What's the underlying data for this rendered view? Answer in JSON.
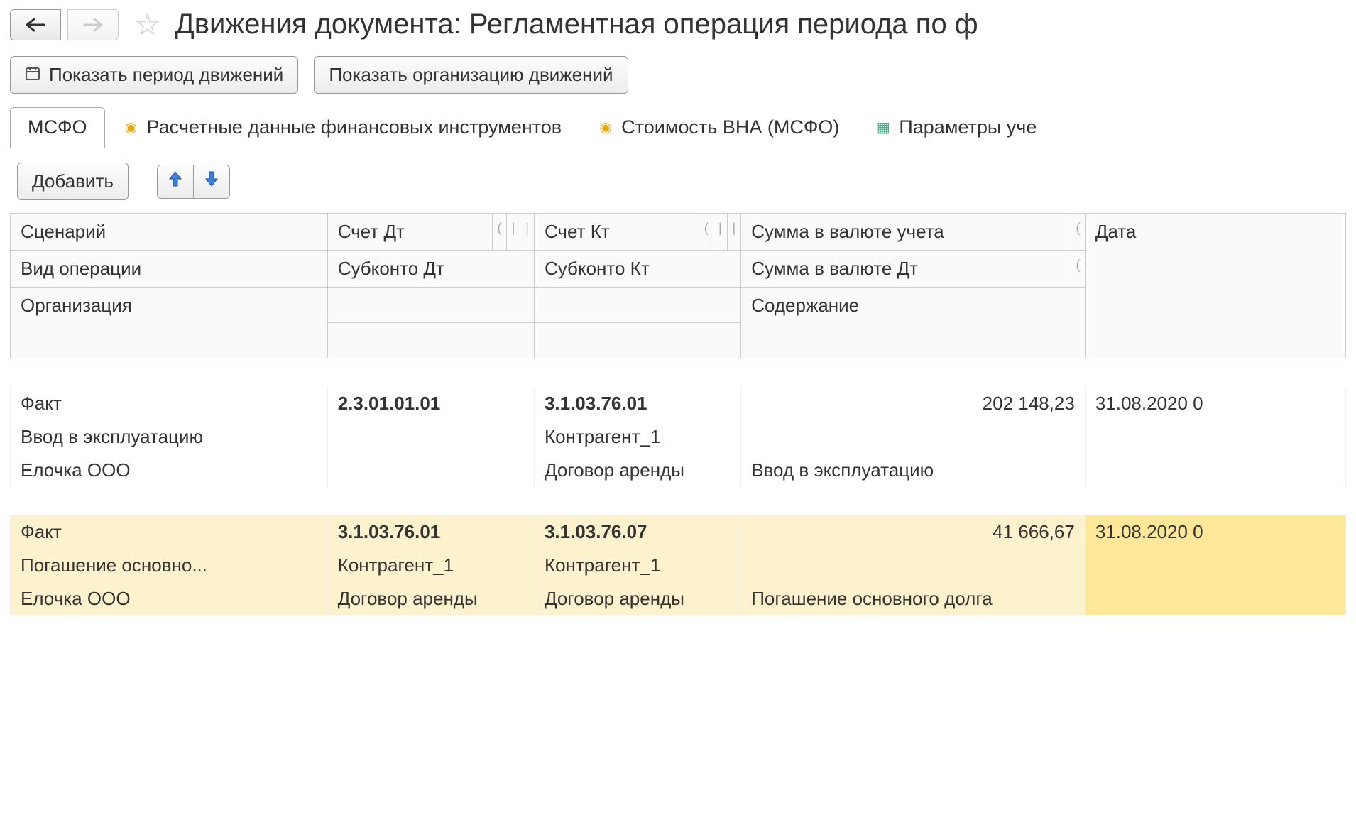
{
  "header": {
    "title": "Движения документа: Регламентная операция периода по ф"
  },
  "toolbar": {
    "show_period": "Показать период движений",
    "show_org": "Показать организацию движений"
  },
  "tabs": [
    {
      "label": "МСФО"
    },
    {
      "label": "Расчетные данные финансовых инструментов"
    },
    {
      "label": "Стоимость ВНА (МСФО)"
    },
    {
      "label": "Параметры уче"
    }
  ],
  "subtoolbar": {
    "add": "Добавить"
  },
  "columns": {
    "r1": {
      "c1": "Сценарий",
      "c2": "Счет Дт",
      "c3": "Счет Кт",
      "c4": "Сумма в валюте учета",
      "c5": "Дата"
    },
    "r2": {
      "c1": "Вид операции",
      "c2": "Субконто Дт",
      "c3": "Субконто Кт",
      "c4": "Сумма в валюте Дт"
    },
    "r3": {
      "c1": "Организация",
      "c4": "Содержание"
    }
  },
  "rows": [
    {
      "scen": "Факт",
      "dt": "2.3.01.01.01",
      "kt": "3.1.03.76.01",
      "sum": "202 148,23",
      "date": "31.08.2020 0",
      "op": "Ввод в эксплуатацию",
      "sub_dt": "",
      "sub_kt": "Контрагент_1",
      "sum_dt": "",
      "org": "Елочка ООО",
      "sub_dt2": "",
      "sub_kt2": "Договор аренды",
      "desc": "Ввод в эксплуатацию"
    },
    {
      "scen": "Факт",
      "dt": "3.1.03.76.01",
      "kt": "3.1.03.76.07",
      "sum": "41 666,67",
      "date": "31.08.2020 0",
      "op": "Погашение основно...",
      "sub_dt": "Контрагент_1",
      "sub_kt": "Контрагент_1",
      "sum_dt": "",
      "org": "Елочка ООО",
      "sub_dt2": "Договор аренды",
      "sub_kt2": "Договор аренды",
      "desc": "Погашение основного долга"
    }
  ]
}
